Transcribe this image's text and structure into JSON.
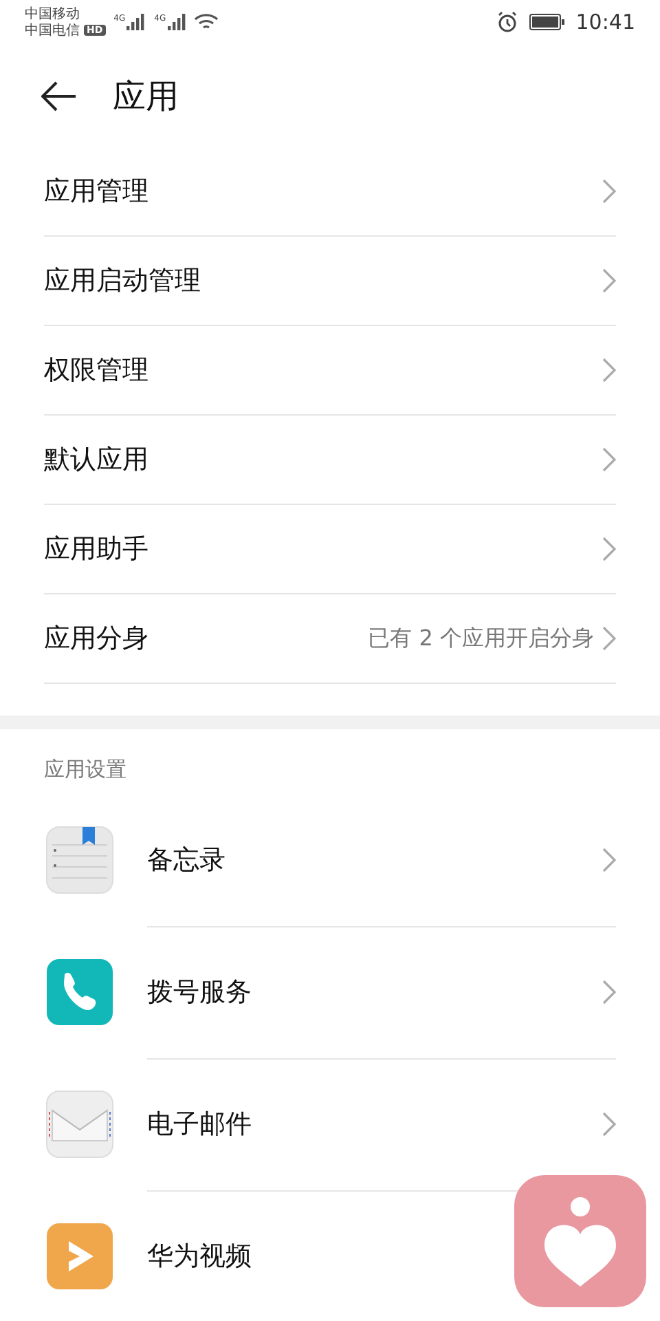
{
  "status_bar": {
    "carriers": [
      "中国移动",
      "中国电信"
    ],
    "hd": "HD",
    "network": [
      "4G",
      "4G"
    ],
    "time": "10:41"
  },
  "header": {
    "title": "应用"
  },
  "menu": [
    {
      "label": "应用管理"
    },
    {
      "label": "应用启动管理"
    },
    {
      "label": "权限管理"
    },
    {
      "label": "默认应用"
    },
    {
      "label": "应用助手"
    },
    {
      "label": "应用分身",
      "detail": "已有 2 个应用开启分身"
    }
  ],
  "section": {
    "title": "应用设置",
    "apps": [
      {
        "kind": "memo",
        "label": "备忘录",
        "chevron": true
      },
      {
        "kind": "phone",
        "label": "拨号服务",
        "chevron": true
      },
      {
        "kind": "mail",
        "label": "电子邮件",
        "chevron": true
      },
      {
        "kind": "video",
        "label": "华为视频",
        "chevron": false
      }
    ]
  }
}
